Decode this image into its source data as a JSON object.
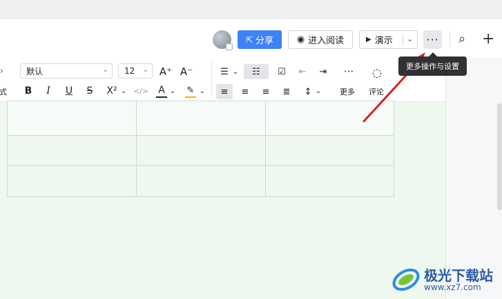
{
  "header": {
    "share_label": "分享",
    "read_mode_label": "进入阅读",
    "present_label": "演示",
    "more_glyph": "···",
    "search_glyph": "⌕",
    "add_glyph": "+"
  },
  "tooltip": {
    "text": "更多操作与设置"
  },
  "ribbon": {
    "font_family_value": "默认",
    "font_size_value": "12",
    "grow_glyph": "A⁺",
    "shrink_glyph": "A⁻",
    "bold": "B",
    "italic": "I",
    "underline": "U",
    "strike": "S",
    "superscript": "X²",
    "code": "</>",
    "font_color": "A",
    "highlight": "✎",
    "more_label": "更多",
    "comment_label": "评论",
    "format_label": "格式",
    "collapse_glyph": "^"
  },
  "colors": {
    "accent": "#3d82f6",
    "doc_background": "#eef8ee",
    "tooltip_bg": "#303133",
    "arrow": "#d42020",
    "font_color_bar": "#222222",
    "highlight_bar": "#f2b400"
  },
  "watermark": {
    "title": "极光下载站",
    "url": "www.xz7.com"
  }
}
